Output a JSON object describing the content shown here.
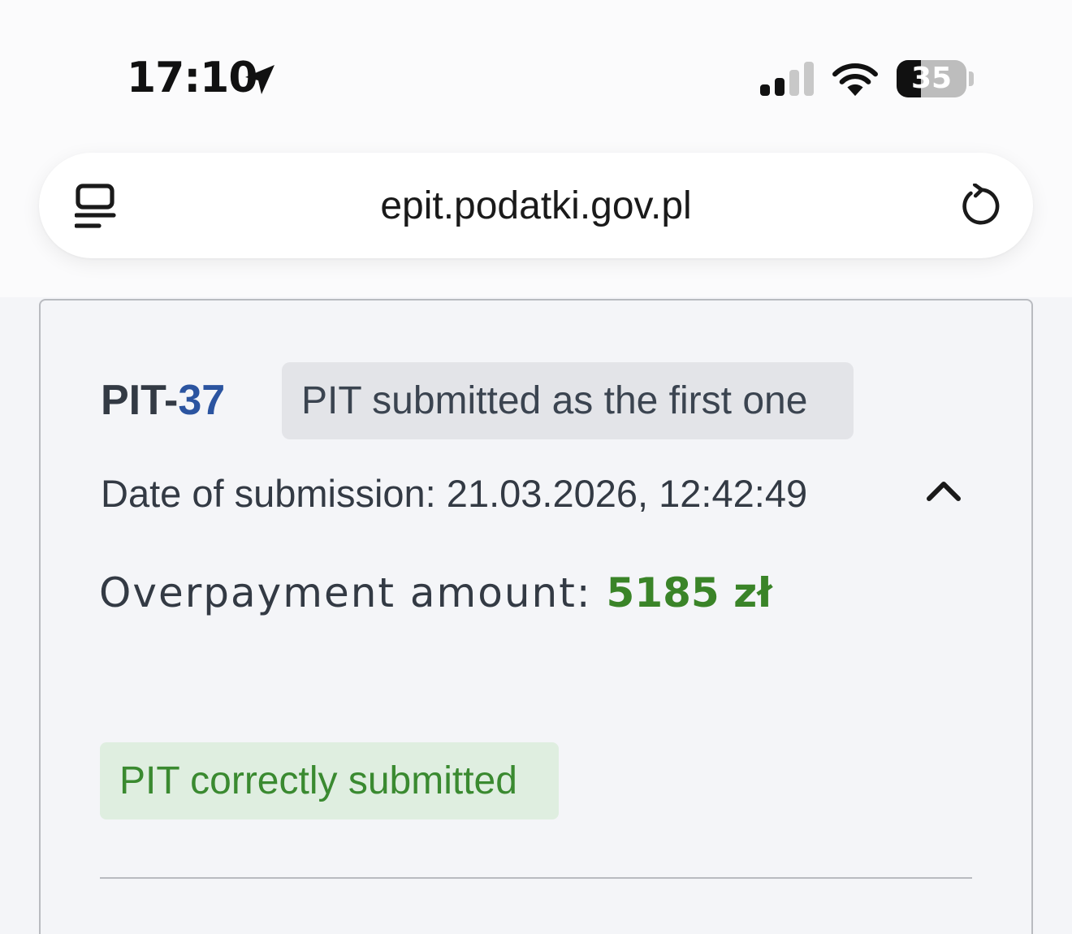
{
  "status_bar": {
    "time": "17:10",
    "battery_text": "35",
    "battery_level": 0.35,
    "icons": [
      "location-arrow-icon",
      "cellular-signal-icon",
      "wifi-icon",
      "battery-icon"
    ]
  },
  "browser": {
    "url": "epit.podatki.gov.pl",
    "icons": [
      "reader-mode-icon",
      "reload-icon"
    ]
  },
  "declaration": {
    "form_prefix": "PIT-",
    "form_number": "37",
    "badge": "PIT submitted as the first one",
    "date_label": "Date of submission: 21.03.2026, 12:42:49",
    "amount_label": "Overpayment amount: ",
    "amount_value": "5185 zł",
    "status": "PIT correctly submitted",
    "collapse_icon": "chevron-up-icon"
  },
  "colors": {
    "accent_blue": "#2b54a0",
    "amount_green": "#3a8428",
    "status_bg": "#dfeee0",
    "status_text": "#3a8a30"
  }
}
